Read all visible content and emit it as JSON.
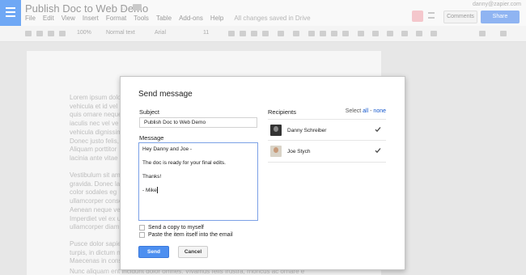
{
  "app": {
    "doc_title": "Publish Doc to Web Demo",
    "user_email": "danny@zapier.com",
    "menu": [
      "File",
      "Edit",
      "View",
      "Insert",
      "Format",
      "Tools",
      "Table",
      "Add-ons",
      "Help"
    ],
    "saved_status": "All changes saved in Drive",
    "comments_label": "Comments",
    "share_label": "Share"
  },
  "toolbar": {
    "zoom": "100%",
    "style": "Normal text",
    "font": "Arial",
    "size": "11"
  },
  "document": {
    "lines_a": [
      "Lorem ipsum dolor",
      "vehicula et id vel",
      "quis ornare neque",
      "iaculis nec vel ve",
      "vehicula dignissim",
      "Donec justo felis,",
      "Aliquam porttitor",
      "lacinia ante vitae"
    ],
    "lines_b": [
      "Vestibulum sit am",
      "gravida. Donec la",
      "color sodales eg",
      "ullamcorper conse",
      "Aenean neque ve",
      "Imperdiet vel ex u",
      "ullamcorper diam"
    ],
    "lines_c": [
      "Pusce dolor sapie",
      "turpis, in dictum n",
      "Maecenas in cons",
      "Nunc aliquam ent"
    ],
    "bottom_line": "Nunc aliquam ent incidunt dolor omnes. Vivamus felis frustra, rhoncus ac ornare e"
  },
  "dialog": {
    "title": "Send message",
    "subject_label": "Subject",
    "subject_value": "Publish Doc to Web Demo",
    "message_label": "Message",
    "message_lines": [
      "Hey Danny and Joe -",
      "The doc is ready for your final edits.",
      "Thanks!",
      "- Mike"
    ],
    "copy_label": "Send a copy to myself",
    "paste_label": "Paste the item itself into the email",
    "send_label": "Send",
    "cancel_label": "Cancel",
    "recipients_label": "Recipients",
    "select_prefix": "Select",
    "select_all": "all",
    "select_separator": "-",
    "select_none": "none",
    "recipients": [
      {
        "name": "Danny Schreiber",
        "checked": true
      },
      {
        "name": "Joe Stych",
        "checked": true
      }
    ]
  }
}
